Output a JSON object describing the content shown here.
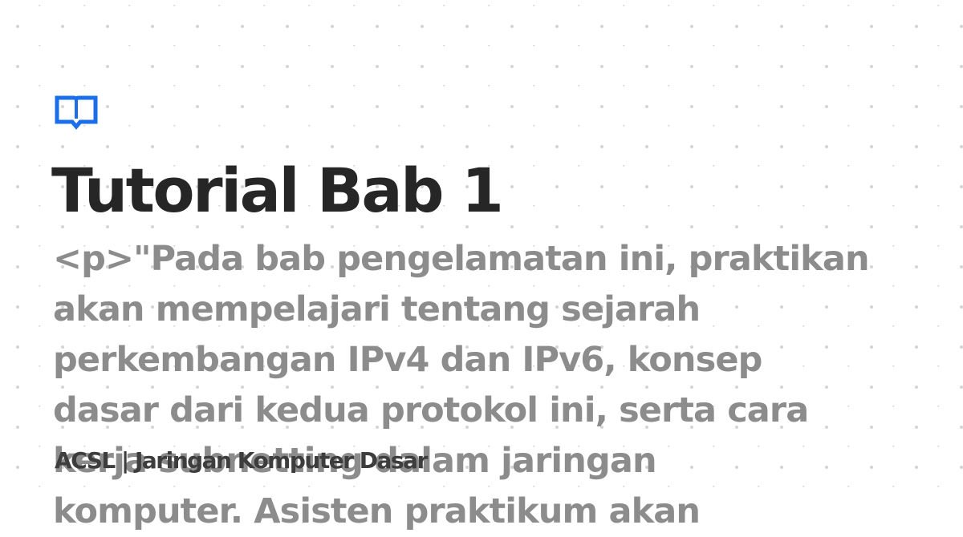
{
  "icon": "open-book-icon",
  "colors": {
    "accent": "#1a6fe8",
    "title": "#262626",
    "description": "#8c8c8c",
    "site_name": "#3d3d3d",
    "pattern": "#d4d4d4"
  },
  "title": "Tutorial Bab 1",
  "description": "<p>\"Pada bab pengelamatan ini, praktikan\nakan mempelajari tentang sejarah\nperkembangan IPv4 dan IPv6, konsep\ndasar dari kedua protokol ini, serta cara\nkerja subnetting dalam jaringan\nkomputer. Asisten praktikum akan",
  "site_name": "ACSL | Jaringan Komputer Dasar"
}
